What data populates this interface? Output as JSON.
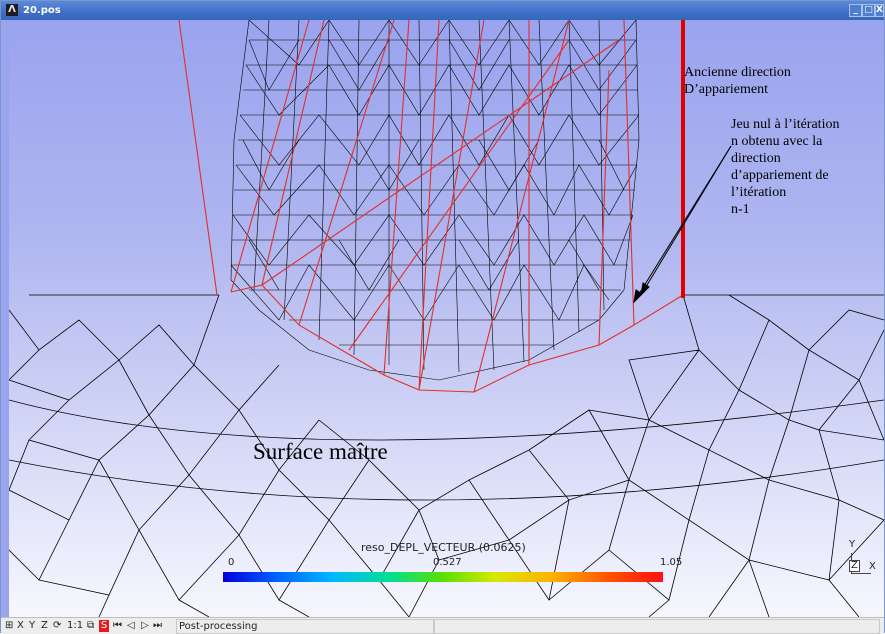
{
  "window": {
    "title": "20.pos",
    "controls": {
      "minimize": "_",
      "maximize": "□",
      "close": "X"
    }
  },
  "annotations": {
    "old_direction_line1": "Ancienne direction",
    "old_direction_line2": "D’appariement",
    "gap_line1": "Jeu nul à l’itération",
    "gap_line2": "n obtenu avec la",
    "gap_line3": "direction",
    "gap_line4": "d’appariement de",
    "gap_line5": "l’itération",
    "gap_line6": "n-1",
    "surface_label": "Surface maître"
  },
  "colorbar": {
    "title": "reso_DEPL_VECTEUR (0.0625)",
    "min": "0",
    "mid": "0.527",
    "max": "1.05"
  },
  "axes": {
    "y": "Y",
    "z": "Z",
    "x": "X"
  },
  "statusbar": {
    "grid": "⊞",
    "x": "X",
    "y": "Y",
    "z": "Z",
    "rotate": "⟳",
    "scale": "1:1",
    "screenshot": "⧉",
    "record": "S",
    "first": "⏮",
    "prev": "◁",
    "play": "▷",
    "next": "⏭",
    "message": "Post-processing"
  },
  "colors": {
    "mesh": "#000000",
    "contact": "#e0302a",
    "old_direction": "#e00000"
  }
}
